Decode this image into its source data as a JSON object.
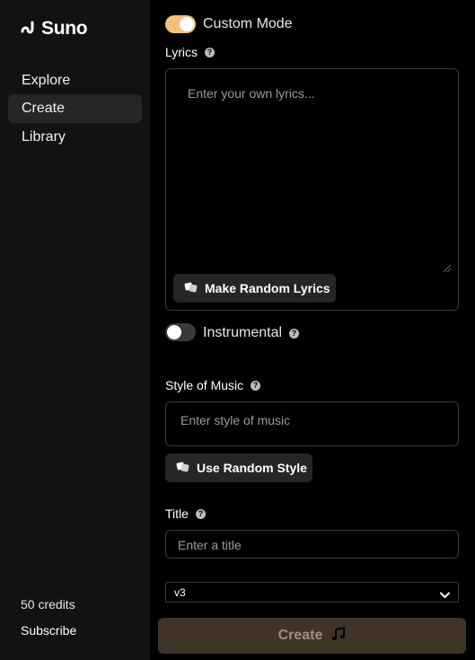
{
  "brand": {
    "name": "Suno"
  },
  "sidebar": {
    "items": [
      {
        "label": "Explore",
        "active": false
      },
      {
        "label": "Create",
        "active": true
      },
      {
        "label": "Library",
        "active": false
      }
    ],
    "credits": "50 credits",
    "subscribe": "Subscribe"
  },
  "form": {
    "custom_mode": {
      "label": "Custom Mode",
      "enabled": true
    },
    "lyrics": {
      "label": "Lyrics",
      "placeholder": "Enter your own lyrics...",
      "random_button": "Make Random Lyrics"
    },
    "instrumental": {
      "label": "Instrumental",
      "enabled": false
    },
    "style": {
      "label": "Style of Music",
      "placeholder": "Enter style of music",
      "random_button": "Use Random Style"
    },
    "title": {
      "label": "Title",
      "placeholder": "Enter a title"
    },
    "version": {
      "selected": "v3"
    },
    "create_button": "Create"
  },
  "colors": {
    "sidebar_bg": "#121212",
    "accent": "#f3c17a",
    "create_btn_bg": "#3f3427"
  },
  "icons": {
    "logo": "suno-wave-icon",
    "help": "question-circle-icon",
    "dice": "dice-icon",
    "music": "music-note-icon",
    "chevron": "chevron-down-icon"
  }
}
